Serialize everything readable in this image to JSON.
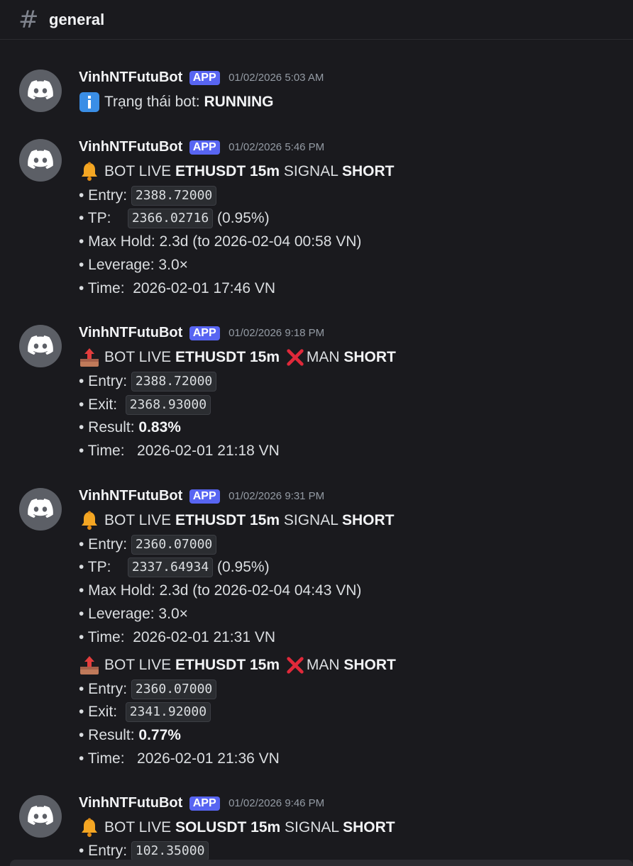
{
  "channel": {
    "name": "general"
  },
  "messages": [
    {
      "username": "VinhNTFutuBot",
      "tag": "APP",
      "timestamp": "01/02/2026 5:03 AM",
      "status_prefix": "Trạng thái bot: ",
      "status_value": "RUNNING"
    },
    {
      "username": "VinhNTFutuBot",
      "tag": "APP",
      "timestamp": "01/02/2026 5:46 PM",
      "title_prefix": "BOT LIVE ",
      "symbol": "ETHUSDT 15m",
      "title_mid": " SIGNAL ",
      "side": "SHORT",
      "entry_label": "• Entry: ",
      "entry": "2388.72000",
      "tp_label": "• TP:    ",
      "tp": "2366.02716",
      "tp_pct": " (0.95%)",
      "maxhold": "• Max Hold: 2.3d (to 2026-02-04 00:58 VN)",
      "leverage": "• Leverage: 3.0×",
      "time": "• Time:  2026-02-01 17:46 VN"
    },
    {
      "username": "VinhNTFutuBot",
      "tag": "APP",
      "timestamp": "01/02/2026 9:18 PM",
      "title_prefix": "BOT LIVE ",
      "symbol": "ETHUSDT 15m",
      "title_mid": "MAN ",
      "side": "SHORT",
      "entry_label": "• Entry: ",
      "entry": "2388.72000",
      "exit_label": "• Exit:  ",
      "exit": "2368.93000",
      "result_label": "• Result: ",
      "result": "0.83%",
      "time": "• Time:   2026-02-01 21:18 VN"
    },
    {
      "username": "VinhNTFutuBot",
      "tag": "APP",
      "timestamp": "01/02/2026 9:31 PM",
      "title_prefix": "BOT LIVE ",
      "symbol": "ETHUSDT 15m",
      "title_mid": " SIGNAL ",
      "side": "SHORT",
      "entry_label": "• Entry: ",
      "entry": "2360.07000",
      "tp_label": "• TP:    ",
      "tp": "2337.64934",
      "tp_pct": " (0.95%)",
      "maxhold": "• Max Hold: 2.3d (to 2026-02-04 04:43 VN)",
      "leverage": "• Leverage: 3.0×",
      "time": "• Time:  2026-02-01 21:31 VN",
      "close": {
        "title_prefix": "BOT LIVE ",
        "symbol": "ETHUSDT 15m",
        "title_mid": "MAN ",
        "side": "SHORT",
        "entry_label": "• Entry: ",
        "entry": "2360.07000",
        "exit_label": "• Exit:  ",
        "exit": "2341.92000",
        "result_label": "• Result: ",
        "result": "0.77%",
        "time": "• Time:   2026-02-01 21:36 VN"
      }
    },
    {
      "username": "VinhNTFutuBot",
      "tag": "APP",
      "timestamp": "01/02/2026 9:46 PM",
      "title_prefix": "BOT LIVE ",
      "symbol": "SOLUSDT 15m",
      "title_mid": " SIGNAL ",
      "side": "SHORT",
      "entry_label": "• Entry: ",
      "entry": "102.35000"
    }
  ],
  "icons": {
    "avatar": "discord-logo-icon",
    "info": "information-icon",
    "bell": "bell-icon",
    "outbox": "outbox-tray-icon",
    "cross": "cross-mark-icon"
  },
  "colors": {
    "background": "#1a1a1e",
    "app_tag": "#5865f2",
    "text": "#dbdee1",
    "timestamp": "#949ba4"
  }
}
